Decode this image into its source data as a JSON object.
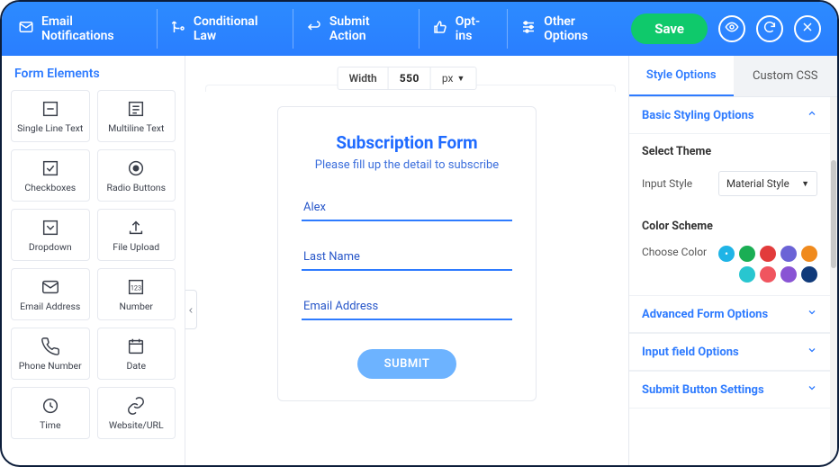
{
  "topbar": {
    "items": [
      {
        "label": "Email Notifications"
      },
      {
        "label": "Conditional Law"
      },
      {
        "label": "Submit Action"
      },
      {
        "label": "Opt-ins"
      },
      {
        "label": "Other Options"
      }
    ],
    "save_label": "Save"
  },
  "left": {
    "title": "Form Elements",
    "elements": [
      "Single Line Text",
      "Multiline Text",
      "Checkboxes",
      "Radio Buttons",
      "Dropdown",
      "File Upload",
      "Email Address",
      "Number",
      "Phone Number",
      "Date",
      "Time",
      "Website/URL"
    ]
  },
  "canvas": {
    "width_label": "Width",
    "width_value": "550",
    "width_unit": "px",
    "form_title": "Subscription Form",
    "form_subtitle": "Please fill up the detail to subscribe",
    "field1_value": "Alex",
    "field2_placeholder": "Last Name",
    "field3_placeholder": "Email Address",
    "submit_label": "SUBMIT"
  },
  "right": {
    "tab_style": "Style Options",
    "tab_css": "Custom CSS",
    "basic_title": "Basic Styling Options",
    "select_theme_title": "Select Theme",
    "input_style_label": "Input Style",
    "input_style_value": "Material Style",
    "color_scheme_title": "Color Scheme",
    "choose_color_label": "Choose Color",
    "swatches": [
      "#1fb4e6",
      "#1aae54",
      "#e23b3b",
      "#6b63d6",
      "#f08a1d",
      "#28c6d0",
      "#f0555f",
      "#8954d4",
      "#103a7a"
    ],
    "selected_swatch": 0,
    "advanced_title": "Advanced Form Options",
    "inputfield_title": "Input field Options",
    "submitbtn_title": "Submit Button Settings"
  }
}
